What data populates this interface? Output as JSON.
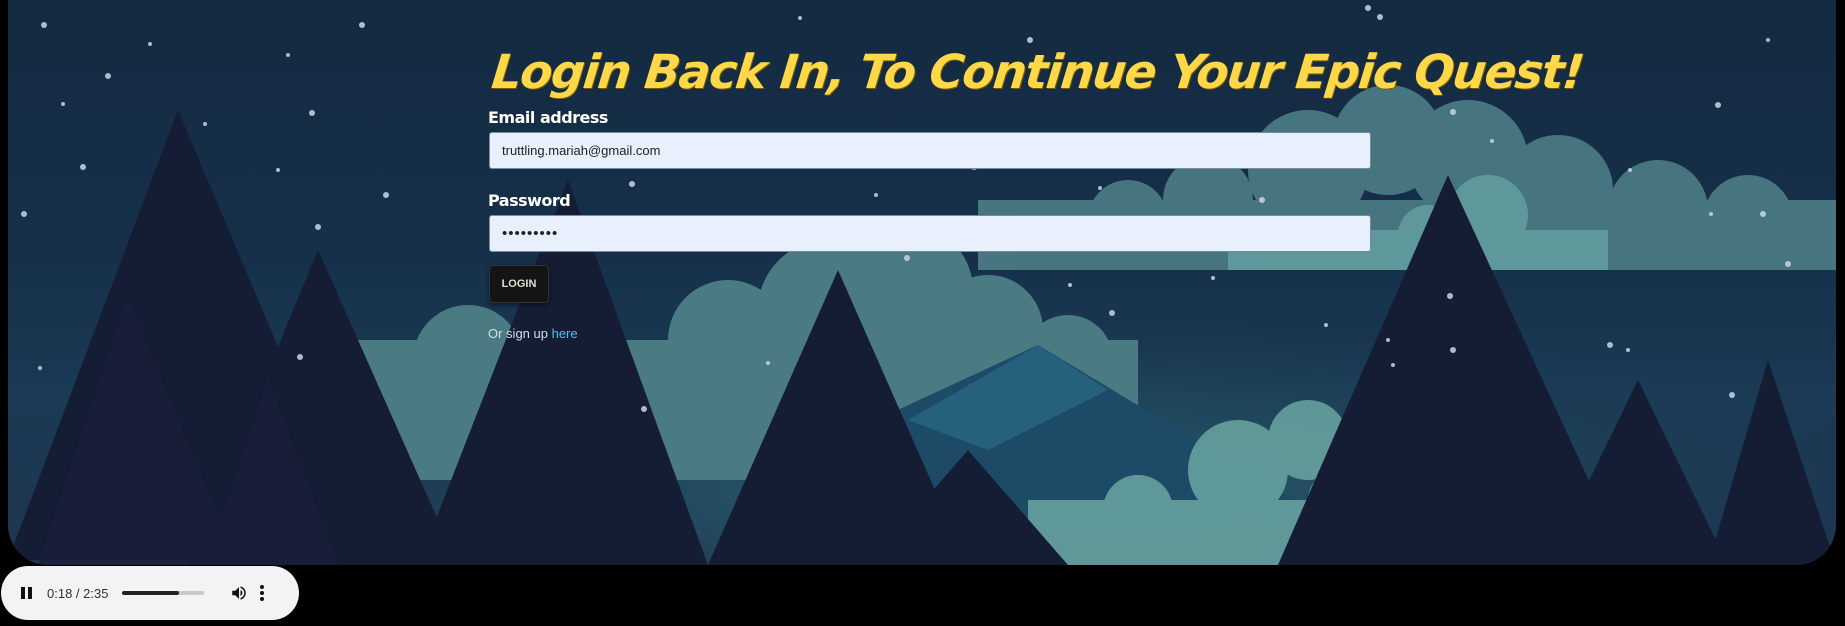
{
  "login": {
    "title": "Login Back In, To Continue Your Epic Quest!",
    "email_label": "Email address",
    "email_value": "truttling.mariah@gmail.com",
    "password_label": "Password",
    "password_value": "•••••••••",
    "login_button": "LOGIN",
    "signup_prefix": "Or sign up ",
    "signup_link": "here"
  },
  "audio_player": {
    "time": "0:18 / 2:35",
    "progress_fraction": 0.69,
    "icons": [
      "pause-icon",
      "volume-icon",
      "more-options-icon"
    ]
  },
  "colors": {
    "title": "#ffd84a",
    "link": "#4fc3f7",
    "input_bg": "#e8f0fe",
    "button_bg": "#141414"
  }
}
